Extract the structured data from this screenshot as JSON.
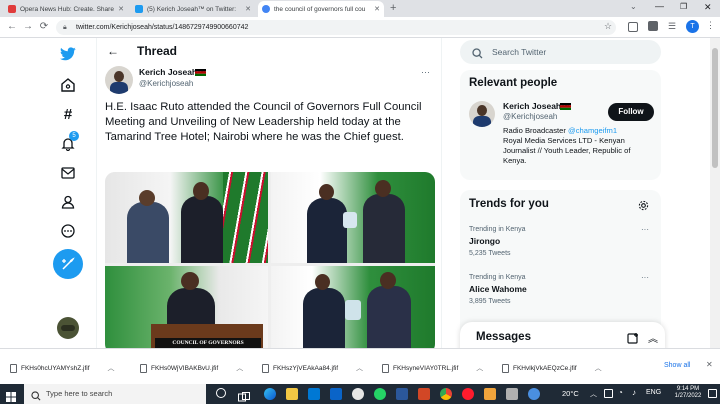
{
  "browser": {
    "tabs": [
      {
        "title": "Opera News Hub: Create. Share",
        "favicon_color": "#e03b3b",
        "active": false
      },
      {
        "title": "(5) Kerich Joseah™ on Twitter:",
        "favicon_color": "#1d9bf0",
        "active": false
      },
      {
        "title": "the council of governors full cou",
        "favicon_color": "#4285f4",
        "active": true
      }
    ],
    "url": "twitter.com/Kerichjoseah/status/1486729749900660742"
  },
  "twitter": {
    "nav_icons": [
      "bird-logo-icon",
      "explore-icon",
      "hashtag-icon",
      "notifications-icon",
      "mail-icon",
      "profile-icon",
      "more-icon"
    ],
    "notification_badge": "5",
    "header": {
      "title": "Thread"
    },
    "tweet": {
      "author_name": "Kerich Joseah™",
      "author_handle": "@Kerichjoseah",
      "text": "H.E. Isaac Ruto attended the Council of Governors Full Council Meeting and Unveiling of New Leadership held today at the Tamarind Tree Hotel; Nairobi where he was the Chief guest.",
      "photo_caption": "COUNCIL OF GOVERNORS"
    },
    "search": {
      "placeholder": "Search Twitter"
    },
    "relevant": {
      "title": "Relevant people",
      "name": "Kerich Joseah™",
      "handle": "@Kerichjoseah",
      "follow_label": "Follow",
      "bio_prefix": "Radio Broadcaster ",
      "bio_link": "@chamgeifm1",
      "bio_rest": "Royal Media Services LTD - Kenyan Journalist // Youth Leader, Republic of Kenya."
    },
    "trends": {
      "title": "Trends for you",
      "items": [
        {
          "context": "Trending in Kenya",
          "name": "Jirongo",
          "count": "5,235 Tweets"
        },
        {
          "context": "Trending in Kenya",
          "name": "Alice Wahome",
          "count": "3,895 Tweets"
        }
      ]
    },
    "messages": {
      "title": "Messages"
    }
  },
  "downloads": {
    "items": [
      "FKHs0hcUYAMYshZ.jfif",
      "FKHs0WjVIBAKBvU.jfif",
      "FKHszYjVEAkAa84.jfif",
      "FKHsyneVIAY0TRL.jfif",
      "FKHvlkjVkAEQzCe.jfif"
    ],
    "show_all": "Show all"
  },
  "taskbar": {
    "search_placeholder": "Type here to search",
    "temperature": "20°C",
    "time": "9:14 PM",
    "date": "1/27/2022"
  },
  "colors": {
    "accent": "#1d9bf0",
    "text": "#0f1419",
    "muted": "#536471"
  }
}
